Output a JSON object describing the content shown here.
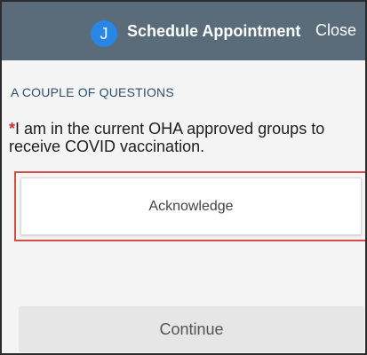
{
  "header": {
    "avatar_initial": "J",
    "title": "Schedule Appointment",
    "close_label": "Close"
  },
  "section": {
    "title": "A COUPLE OF QUESTIONS"
  },
  "question": {
    "required_marker": "*",
    "text": "I am in the current OHA approved groups to receive COVID vaccination."
  },
  "acknowledge": {
    "label": "Acknowledge"
  },
  "footer": {
    "continue_label": "Continue"
  },
  "colors": {
    "header_bg": "#5a6b79",
    "avatar_bg": "#2a86e6",
    "required": "#d42e2e",
    "highlight_border": "#d94b4b"
  }
}
